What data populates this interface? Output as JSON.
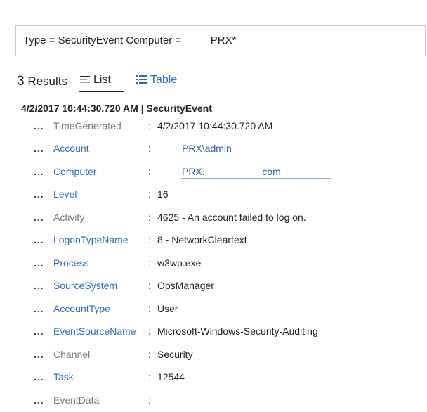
{
  "query": {
    "text": "Type = SecurityEvent Computer =          PRX*"
  },
  "results": {
    "count": "3",
    "label": "Results",
    "tabs": [
      {
        "label": "List",
        "icon": "list-icon"
      },
      {
        "label": "Table",
        "icon": "table-icon"
      }
    ]
  },
  "record": {
    "header": "4/2/2017 10:44:30.720 AM | SecurityEvent",
    "fields": [
      {
        "name": "TimeGenerated",
        "value": "4/2/2017 10:44:30.720 AM",
        "link": false
      },
      {
        "name": "Account",
        "value": "PRX\\admin",
        "link": true
      },
      {
        "name": "Computer",
        "value": "PRX.                    .com",
        "link": true
      },
      {
        "name": "Level",
        "value": "16",
        "link": true
      },
      {
        "name": "Activity",
        "value": "4625 - An account failed to log on.",
        "link": false
      },
      {
        "name": "LogonTypeName",
        "value": "8 - NetworkCleartext",
        "link": true
      },
      {
        "name": "Process",
        "value": "w3wp.exe",
        "link": true
      },
      {
        "name": "SourceSystem",
        "value": "OpsManager",
        "link": true
      },
      {
        "name": "AccountType",
        "value": "User",
        "link": true
      },
      {
        "name": "EventSourceName",
        "value": "Microsoft-Windows-Security-Auditing",
        "link": true
      },
      {
        "name": "Channel",
        "value": "Security",
        "link": false
      },
      {
        "name": "Task",
        "value": "12544",
        "link": true
      },
      {
        "name": "EventData",
        "value": "",
        "link": false
      }
    ]
  },
  "colors": {
    "link": "#2a6ebb",
    "muted": "#777777"
  }
}
